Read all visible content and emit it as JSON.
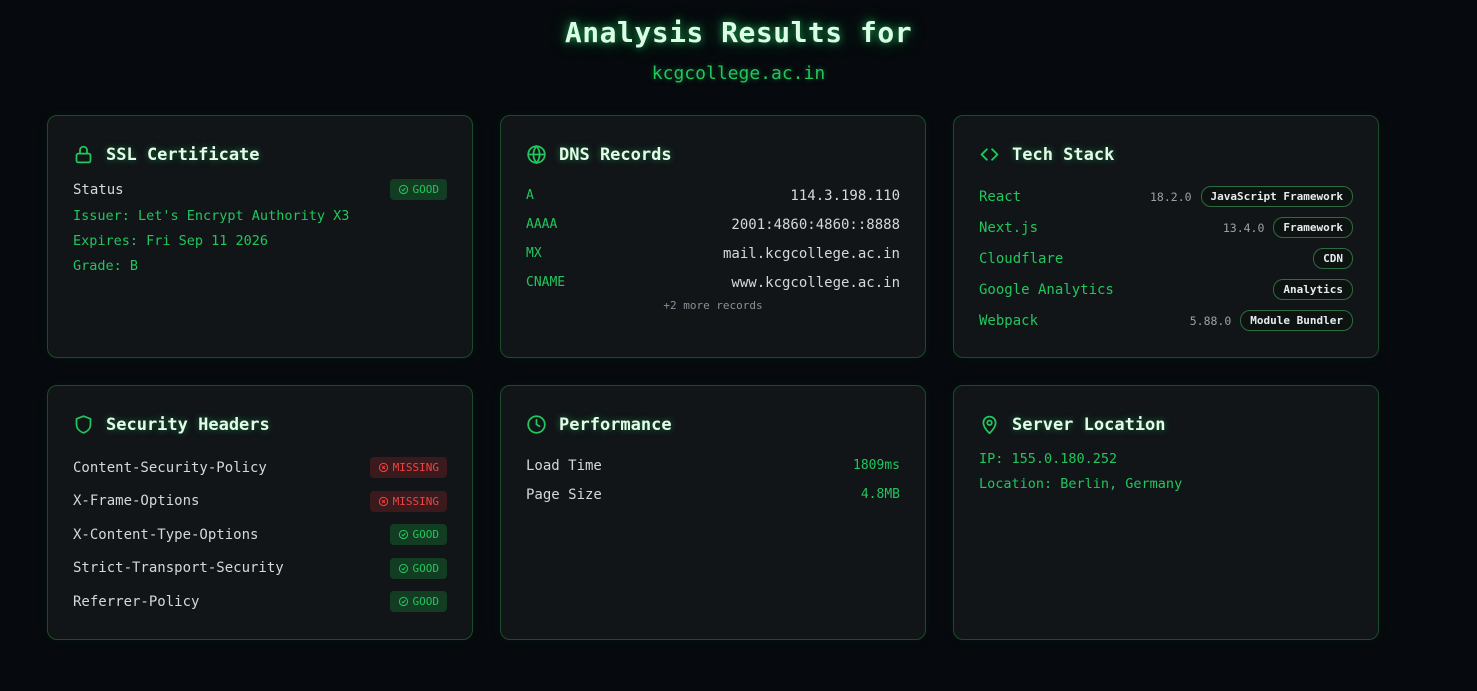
{
  "header": {
    "title": "Analysis Results for",
    "domain": "kcgcollege.ac.in"
  },
  "colors": {
    "accent": "#22c55e",
    "danger": "#ef4444",
    "background": "#06090d",
    "card": "#111518"
  },
  "ssl": {
    "title": "SSL Certificate",
    "icon": "lock-icon",
    "status_label": "Status",
    "status_badge": "GOOD",
    "issuer": "Issuer: Let's Encrypt Authority X3",
    "expires": "Expires: Fri Sep 11 2026",
    "grade": "Grade: B"
  },
  "dns": {
    "title": "DNS Records",
    "icon": "globe-icon",
    "records": [
      {
        "type": "A",
        "value": "114.3.198.110"
      },
      {
        "type": "AAAA",
        "value": "2001:4860:4860::8888"
      },
      {
        "type": "MX",
        "value": "mail.kcgcollege.ac.in"
      },
      {
        "type": "CNAME",
        "value": "www.kcgcollege.ac.in"
      }
    ],
    "more": "+2 more records"
  },
  "tech": {
    "title": "Tech Stack",
    "icon": "code-icon",
    "items": [
      {
        "name": "React",
        "version": "18.2.0",
        "category": "JavaScript Framework"
      },
      {
        "name": "Next.js",
        "version": "13.4.0",
        "category": "Framework"
      },
      {
        "name": "Cloudflare",
        "version": "",
        "category": "CDN"
      },
      {
        "name": "Google Analytics",
        "version": "",
        "category": "Analytics"
      },
      {
        "name": "Webpack",
        "version": "5.88.0",
        "category": "Module Bundler"
      }
    ]
  },
  "security": {
    "title": "Security Headers",
    "icon": "shield-icon",
    "headers": [
      {
        "name": "Content-Security-Policy",
        "status": "MISSING"
      },
      {
        "name": "X-Frame-Options",
        "status": "MISSING"
      },
      {
        "name": "X-Content-Type-Options",
        "status": "GOOD"
      },
      {
        "name": "Strict-Transport-Security",
        "status": "GOOD"
      },
      {
        "name": "Referrer-Policy",
        "status": "GOOD"
      }
    ]
  },
  "performance": {
    "title": "Performance",
    "icon": "clock-icon",
    "metrics": [
      {
        "label": "Load Time",
        "value": "1809ms"
      },
      {
        "label": "Page Size",
        "value": "4.8MB"
      }
    ]
  },
  "location": {
    "title": "Server Location",
    "icon": "map-pin-icon",
    "ip": "IP: 155.0.180.252",
    "location": "Location: Berlin, Germany"
  }
}
